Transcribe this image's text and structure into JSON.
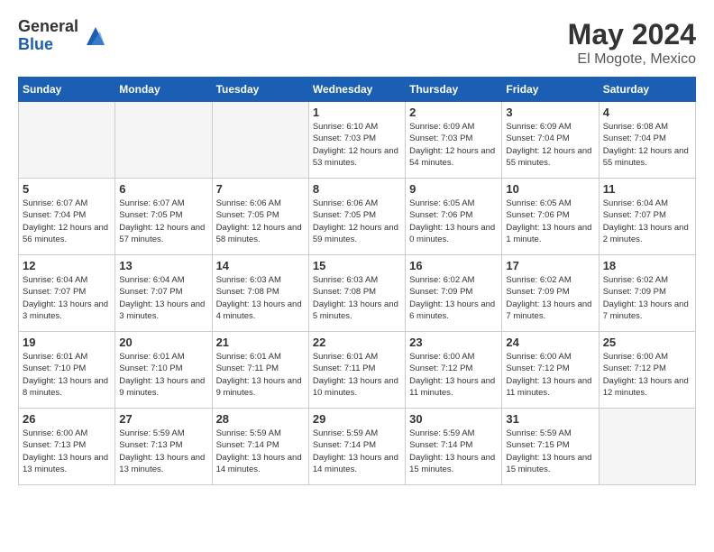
{
  "header": {
    "logo_general": "General",
    "logo_blue": "Blue",
    "title": "May 2024",
    "location": "El Mogote, Mexico"
  },
  "weekdays": [
    "Sunday",
    "Monday",
    "Tuesday",
    "Wednesday",
    "Thursday",
    "Friday",
    "Saturday"
  ],
  "weeks": [
    [
      {
        "day": "",
        "empty": true
      },
      {
        "day": "",
        "empty": true
      },
      {
        "day": "",
        "empty": true
      },
      {
        "day": "1",
        "sunrise": "6:10 AM",
        "sunset": "7:03 PM",
        "daylight": "12 hours and 53 minutes."
      },
      {
        "day": "2",
        "sunrise": "6:09 AM",
        "sunset": "7:03 PM",
        "daylight": "12 hours and 54 minutes."
      },
      {
        "day": "3",
        "sunrise": "6:09 AM",
        "sunset": "7:04 PM",
        "daylight": "12 hours and 55 minutes."
      },
      {
        "day": "4",
        "sunrise": "6:08 AM",
        "sunset": "7:04 PM",
        "daylight": "12 hours and 55 minutes."
      }
    ],
    [
      {
        "day": "5",
        "sunrise": "6:07 AM",
        "sunset": "7:04 PM",
        "daylight": "12 hours and 56 minutes."
      },
      {
        "day": "6",
        "sunrise": "6:07 AM",
        "sunset": "7:05 PM",
        "daylight": "12 hours and 57 minutes."
      },
      {
        "day": "7",
        "sunrise": "6:06 AM",
        "sunset": "7:05 PM",
        "daylight": "12 hours and 58 minutes."
      },
      {
        "day": "8",
        "sunrise": "6:06 AM",
        "sunset": "7:05 PM",
        "daylight": "12 hours and 59 minutes."
      },
      {
        "day": "9",
        "sunrise": "6:05 AM",
        "sunset": "7:06 PM",
        "daylight": "13 hours and 0 minutes."
      },
      {
        "day": "10",
        "sunrise": "6:05 AM",
        "sunset": "7:06 PM",
        "daylight": "13 hours and 1 minute."
      },
      {
        "day": "11",
        "sunrise": "6:04 AM",
        "sunset": "7:07 PM",
        "daylight": "13 hours and 2 minutes."
      }
    ],
    [
      {
        "day": "12",
        "sunrise": "6:04 AM",
        "sunset": "7:07 PM",
        "daylight": "13 hours and 3 minutes."
      },
      {
        "day": "13",
        "sunrise": "6:04 AM",
        "sunset": "7:07 PM",
        "daylight": "13 hours and 3 minutes."
      },
      {
        "day": "14",
        "sunrise": "6:03 AM",
        "sunset": "7:08 PM",
        "daylight": "13 hours and 4 minutes."
      },
      {
        "day": "15",
        "sunrise": "6:03 AM",
        "sunset": "7:08 PM",
        "daylight": "13 hours and 5 minutes."
      },
      {
        "day": "16",
        "sunrise": "6:02 AM",
        "sunset": "7:09 PM",
        "daylight": "13 hours and 6 minutes."
      },
      {
        "day": "17",
        "sunrise": "6:02 AM",
        "sunset": "7:09 PM",
        "daylight": "13 hours and 7 minutes."
      },
      {
        "day": "18",
        "sunrise": "6:02 AM",
        "sunset": "7:09 PM",
        "daylight": "13 hours and 7 minutes."
      }
    ],
    [
      {
        "day": "19",
        "sunrise": "6:01 AM",
        "sunset": "7:10 PM",
        "daylight": "13 hours and 8 minutes."
      },
      {
        "day": "20",
        "sunrise": "6:01 AM",
        "sunset": "7:10 PM",
        "daylight": "13 hours and 9 minutes."
      },
      {
        "day": "21",
        "sunrise": "6:01 AM",
        "sunset": "7:11 PM",
        "daylight": "13 hours and 9 minutes."
      },
      {
        "day": "22",
        "sunrise": "6:01 AM",
        "sunset": "7:11 PM",
        "daylight": "13 hours and 10 minutes."
      },
      {
        "day": "23",
        "sunrise": "6:00 AM",
        "sunset": "7:12 PM",
        "daylight": "13 hours and 11 minutes."
      },
      {
        "day": "24",
        "sunrise": "6:00 AM",
        "sunset": "7:12 PM",
        "daylight": "13 hours and 11 minutes."
      },
      {
        "day": "25",
        "sunrise": "6:00 AM",
        "sunset": "7:12 PM",
        "daylight": "13 hours and 12 minutes."
      }
    ],
    [
      {
        "day": "26",
        "sunrise": "6:00 AM",
        "sunset": "7:13 PM",
        "daylight": "13 hours and 13 minutes."
      },
      {
        "day": "27",
        "sunrise": "5:59 AM",
        "sunset": "7:13 PM",
        "daylight": "13 hours and 13 minutes."
      },
      {
        "day": "28",
        "sunrise": "5:59 AM",
        "sunset": "7:14 PM",
        "daylight": "13 hours and 14 minutes."
      },
      {
        "day": "29",
        "sunrise": "5:59 AM",
        "sunset": "7:14 PM",
        "daylight": "13 hours and 14 minutes."
      },
      {
        "day": "30",
        "sunrise": "5:59 AM",
        "sunset": "7:14 PM",
        "daylight": "13 hours and 15 minutes."
      },
      {
        "day": "31",
        "sunrise": "5:59 AM",
        "sunset": "7:15 PM",
        "daylight": "13 hours and 15 minutes."
      },
      {
        "day": "",
        "empty": true
      }
    ]
  ]
}
